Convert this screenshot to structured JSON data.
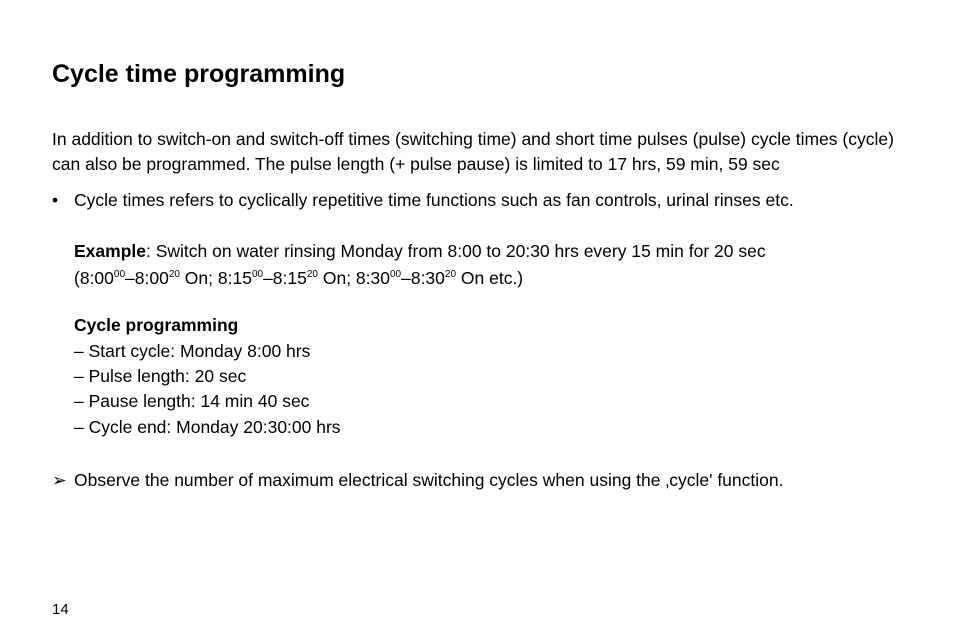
{
  "heading": "Cycle time programming",
  "intro": "In addition to switch-on and switch-off times (switching time) and short time pulses (pulse) cycle times (cycle) can also be programmed. The pulse length (+ pulse pause) is limited to 17 hrs, 59 min, 59 sec",
  "bullet": "Cycle times refers to cyclically repetitive time functions such as fan controls, urinal rinses etc.",
  "example": {
    "label": "Example",
    "text": ": Switch on water rinsing Monday from 8:00 to 20:30 hrs every 15 min for 20 sec",
    "times_prefix": "(8:00",
    "sup1": "00",
    "dash1": "–8:00",
    "sup2": "20",
    "on1": " On; 8:15",
    "sup3": "00",
    "dash2": "–8:15",
    "sup4": "20",
    "on2": " On; 8:30",
    "sup5": "00",
    "dash3": "–8:30",
    "sup6": "20",
    "on3": " On etc.)"
  },
  "cycle": {
    "heading": "Cycle programming",
    "items": [
      "– Start cycle: Monday 8:00 hrs",
      "– Pulse length: 20 sec",
      "– Pause length: 14 min 40 sec",
      "– Cycle end: Monday 20:30:00 hrs"
    ]
  },
  "note": "Observe the number of maximum electrical switching cycles when using the ‚cycle' function.",
  "page": "14"
}
